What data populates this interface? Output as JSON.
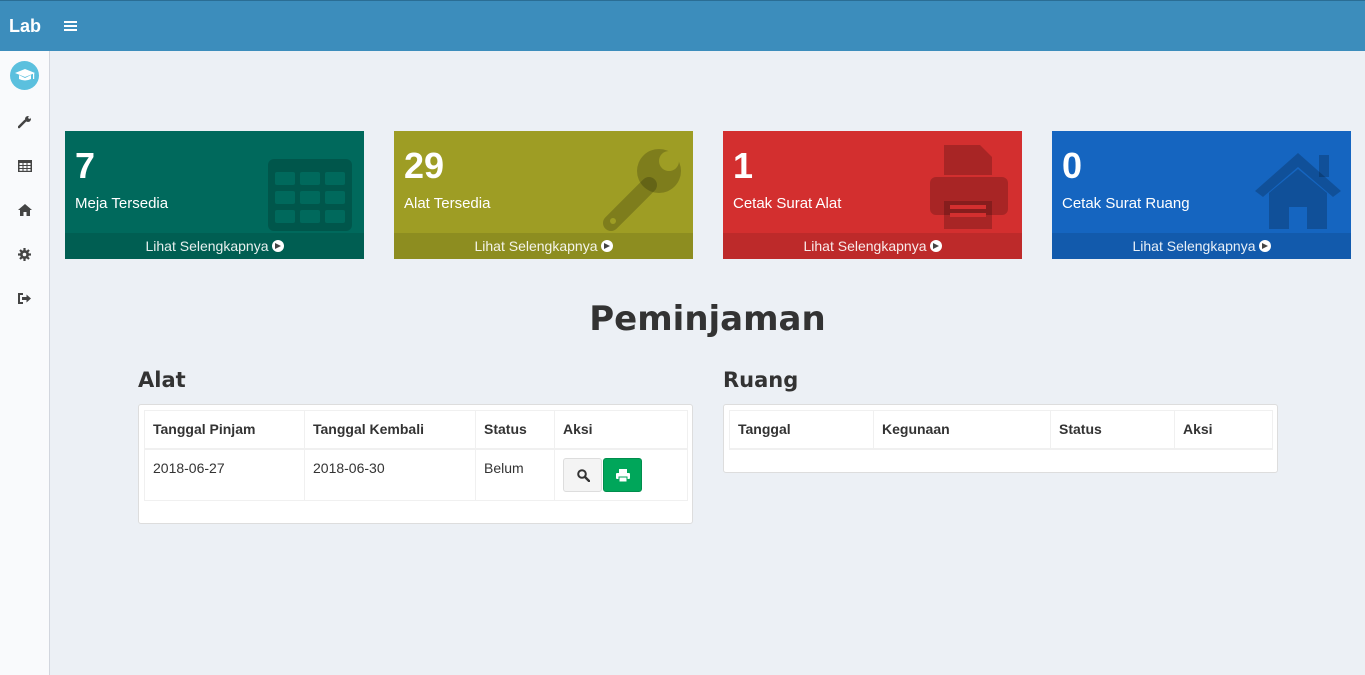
{
  "brand": "Lab",
  "sidebar": {
    "items": [
      {
        "icon": "graduation-cap-icon"
      },
      {
        "icon": "wrench-icon"
      },
      {
        "icon": "table-icon"
      },
      {
        "icon": "home-icon"
      },
      {
        "icon": "gear-icon"
      },
      {
        "icon": "sign-out-icon"
      }
    ]
  },
  "cards": [
    {
      "value": "7",
      "label": "Meja Tersedia",
      "link": "Lihat Selengkapnya",
      "icon": "table-icon",
      "color": "#00695c"
    },
    {
      "value": "29",
      "label": "Alat Tersedia",
      "link": "Lihat Selengkapnya",
      "icon": "wrench-icon",
      "color": "#9e9d24"
    },
    {
      "value": "1",
      "label": "Cetak Surat Alat",
      "link": "Lihat Selengkapnya",
      "icon": "print-icon",
      "color": "#d32f2f"
    },
    {
      "value": "0",
      "label": "Cetak Surat Ruang",
      "link": "Lihat Selengkapnya",
      "icon": "home-icon",
      "color": "#1565c0"
    }
  ],
  "main": {
    "title": "Peminjaman",
    "alat": {
      "title": "Alat",
      "headers": [
        "Tanggal Pinjam",
        "Tanggal Kembali",
        "Status",
        "Aksi"
      ],
      "rows": [
        {
          "pinjam": "2018-06-27",
          "kembali": "2018-06-30",
          "status": "Belum"
        }
      ]
    },
    "ruang": {
      "title": "Ruang",
      "headers": [
        "Tanggal",
        "Kegunaan",
        "Status",
        "Aksi"
      ],
      "rows": []
    }
  }
}
